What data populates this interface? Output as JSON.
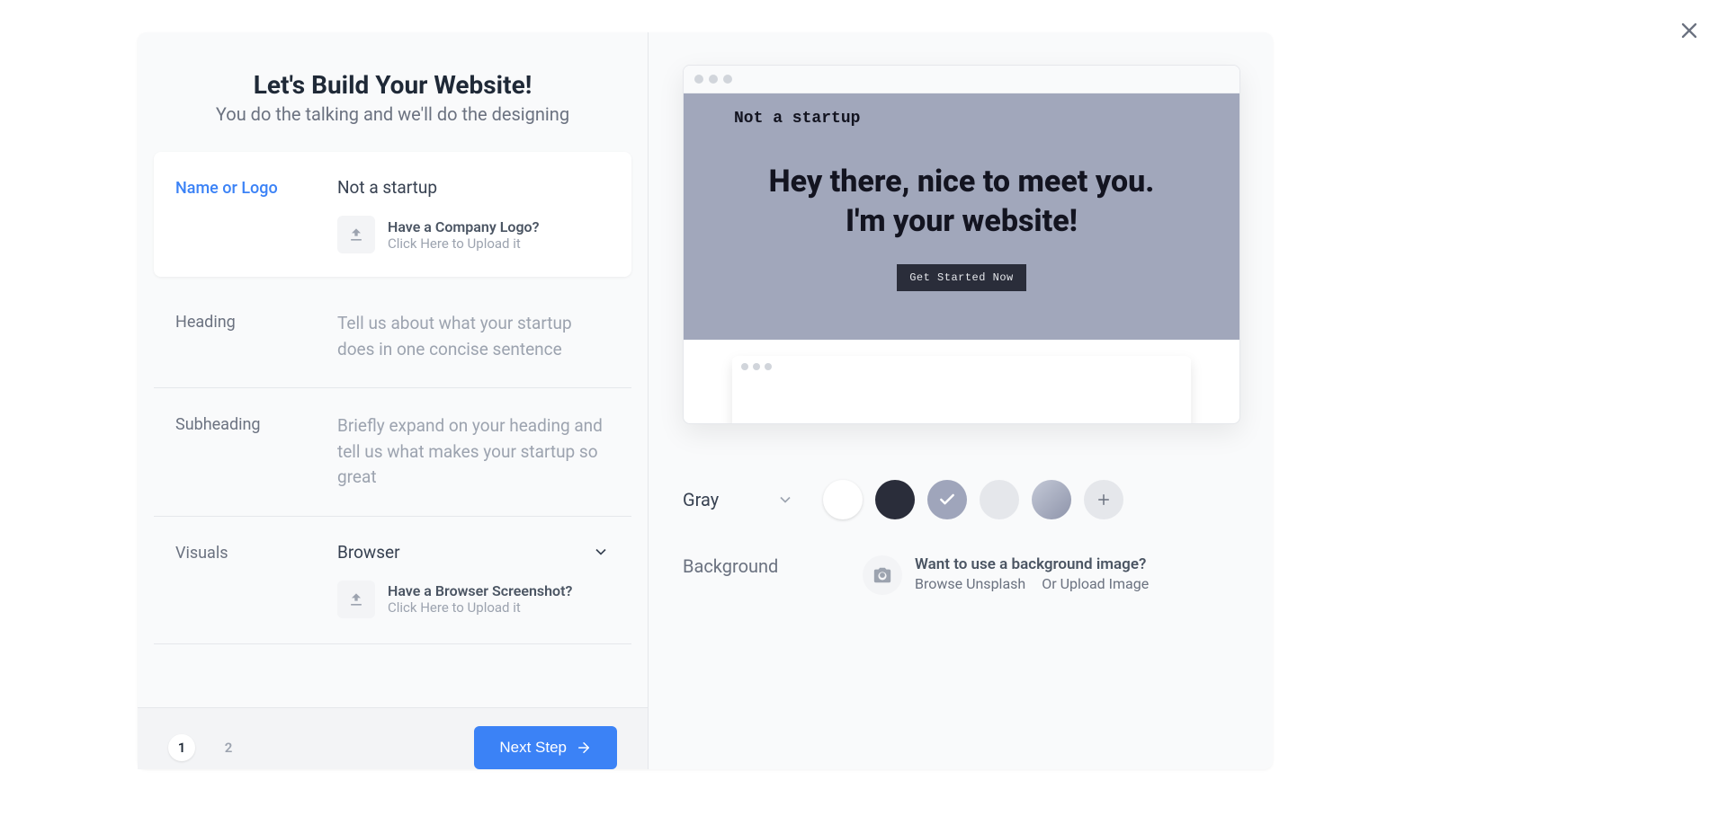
{
  "close_label": "×",
  "header": {
    "title": "Let's Build Your Website!",
    "subtitle": "You do the talking and we'll do the designing"
  },
  "form": {
    "name_logo": {
      "label": "Name or Logo",
      "value": "Not a startup",
      "upload_title": "Have a Company Logo?",
      "upload_sub": "Click Here to Upload it"
    },
    "heading": {
      "label": "Heading",
      "placeholder": "Tell us about what your startup does in one concise sentence"
    },
    "subheading": {
      "label": "Subheading",
      "placeholder": "Briefly expand on your heading and tell us what makes your startup so great"
    },
    "visuals": {
      "label": "Visuals",
      "value": "Browser",
      "upload_title": "Have a Browser Screenshot?",
      "upload_sub": "Click Here to Upload it"
    }
  },
  "footer": {
    "step1": "1",
    "step2": "2",
    "next": "Next Step"
  },
  "preview": {
    "brand": "Not a startup",
    "hero_line1": "Hey there, nice to meet you.",
    "hero_line2": "I'm your website!",
    "cta": "Get Started Now"
  },
  "colors": {
    "selected_label": "Gray",
    "swatches": {
      "white": "#ffffff",
      "dark": "#2a2d3a",
      "gray": "#9fa5bb",
      "light": "#e5e7eb"
    }
  },
  "background": {
    "label": "Background",
    "question": "Want to use a background image?",
    "browse": "Browse Unsplash",
    "upload": "Or Upload Image"
  }
}
